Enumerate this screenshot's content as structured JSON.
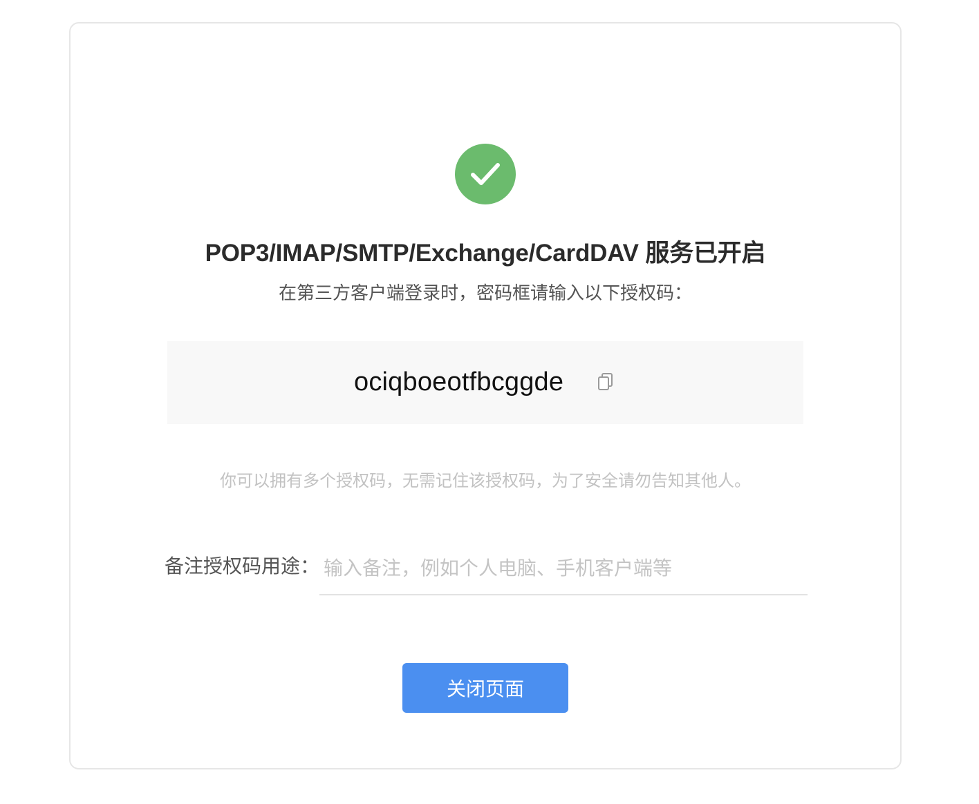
{
  "status": {
    "icon": "checkmark-circle-icon",
    "color": "#6bbb6d",
    "title": "POP3/IMAP/SMTP/Exchange/CardDAV 服务已开启",
    "subtitle": "在第三方客户端登录时，密码框请输入以下授权码："
  },
  "auth_code": {
    "value": "ociqboeotfbcggde",
    "copy_icon": "copy-icon"
  },
  "hint": "你可以拥有多个授权码，无需记住该授权码，为了安全请勿告知其他人。",
  "note_field": {
    "label": "备注授权码用途：",
    "value": "",
    "placeholder": "输入备注，例如个人电脑、手机客户端等"
  },
  "actions": {
    "close_label": "关闭页面",
    "button_color": "#4b8ff0"
  }
}
